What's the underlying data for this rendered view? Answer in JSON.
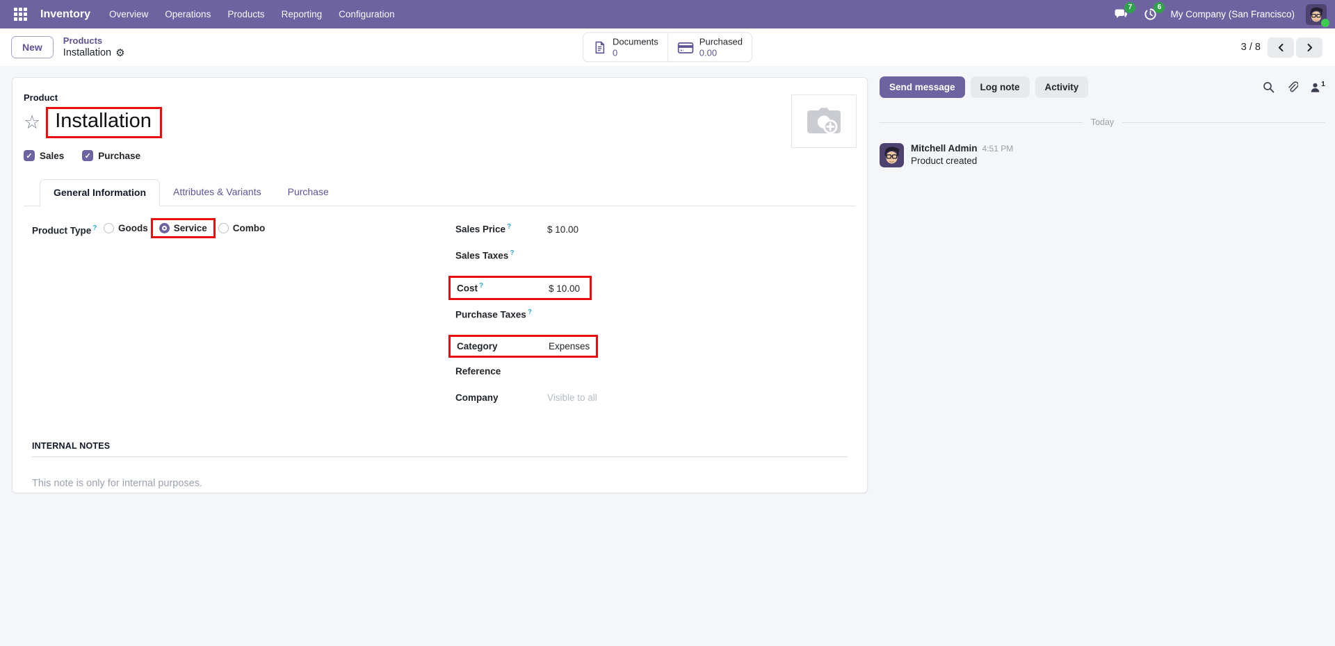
{
  "app": {
    "name": "Inventory",
    "menus": [
      "Overview",
      "Operations",
      "Products",
      "Reporting",
      "Configuration"
    ]
  },
  "systray": {
    "messages_badge": "7",
    "activities_badge": "6",
    "company": "My Company (San Francisco)"
  },
  "control_panel": {
    "new_label": "New",
    "breadcrumb_parent": "Products",
    "breadcrumb_current": "Installation",
    "pager": "3 / 8"
  },
  "stat_buttons": [
    {
      "icon": "document-icon",
      "label": "Documents",
      "value": "0"
    },
    {
      "icon": "credit-card-icon",
      "label": "Purchased",
      "value": "0.00"
    }
  ],
  "icons": {
    "star": "☆",
    "gear": "⚙",
    "check": "✓"
  },
  "form": {
    "product_label": "Product",
    "title": "Installation",
    "help_marker": "?",
    "checkboxes": [
      {
        "label": "Sales",
        "checked": true
      },
      {
        "label": "Purchase",
        "checked": true
      }
    ],
    "tabs": [
      {
        "label": "General Information",
        "active": true
      },
      {
        "label": "Attributes & Variants",
        "active": false
      },
      {
        "label": "Purchase",
        "active": false
      }
    ],
    "product_type": {
      "label": "Product Type",
      "options": [
        {
          "label": "Goods",
          "selected": false
        },
        {
          "label": "Service",
          "selected": true
        },
        {
          "label": "Combo",
          "selected": false
        }
      ]
    },
    "fields": {
      "sales_price": {
        "label": "Sales Price",
        "value": "$ 10.00"
      },
      "sales_taxes": {
        "label": "Sales Taxes",
        "value": ""
      },
      "cost": {
        "label": "Cost",
        "value": "$ 10.00"
      },
      "purchase_taxes": {
        "label": "Purchase Taxes",
        "value": ""
      },
      "category": {
        "label": "Category",
        "value": "Expenses"
      },
      "reference": {
        "label": "Reference",
        "value": ""
      },
      "company": {
        "label": "Company",
        "placeholder": "Visible to all"
      }
    },
    "internal_notes": {
      "heading": "INTERNAL NOTES",
      "placeholder": "This note is only for internal purposes."
    }
  },
  "chatter": {
    "buttons": [
      "Send message",
      "Log note",
      "Activity"
    ],
    "followers_count": "1",
    "divider": "Today",
    "messages": [
      {
        "author": "Mitchell Admin",
        "time": "4:51 PM",
        "body": "Product created"
      }
    ]
  },
  "colors": {
    "accent": "#6e63a1",
    "link": "#5d5394",
    "highlight_red": "#e90d0d",
    "badge_green": "#31a24c"
  }
}
